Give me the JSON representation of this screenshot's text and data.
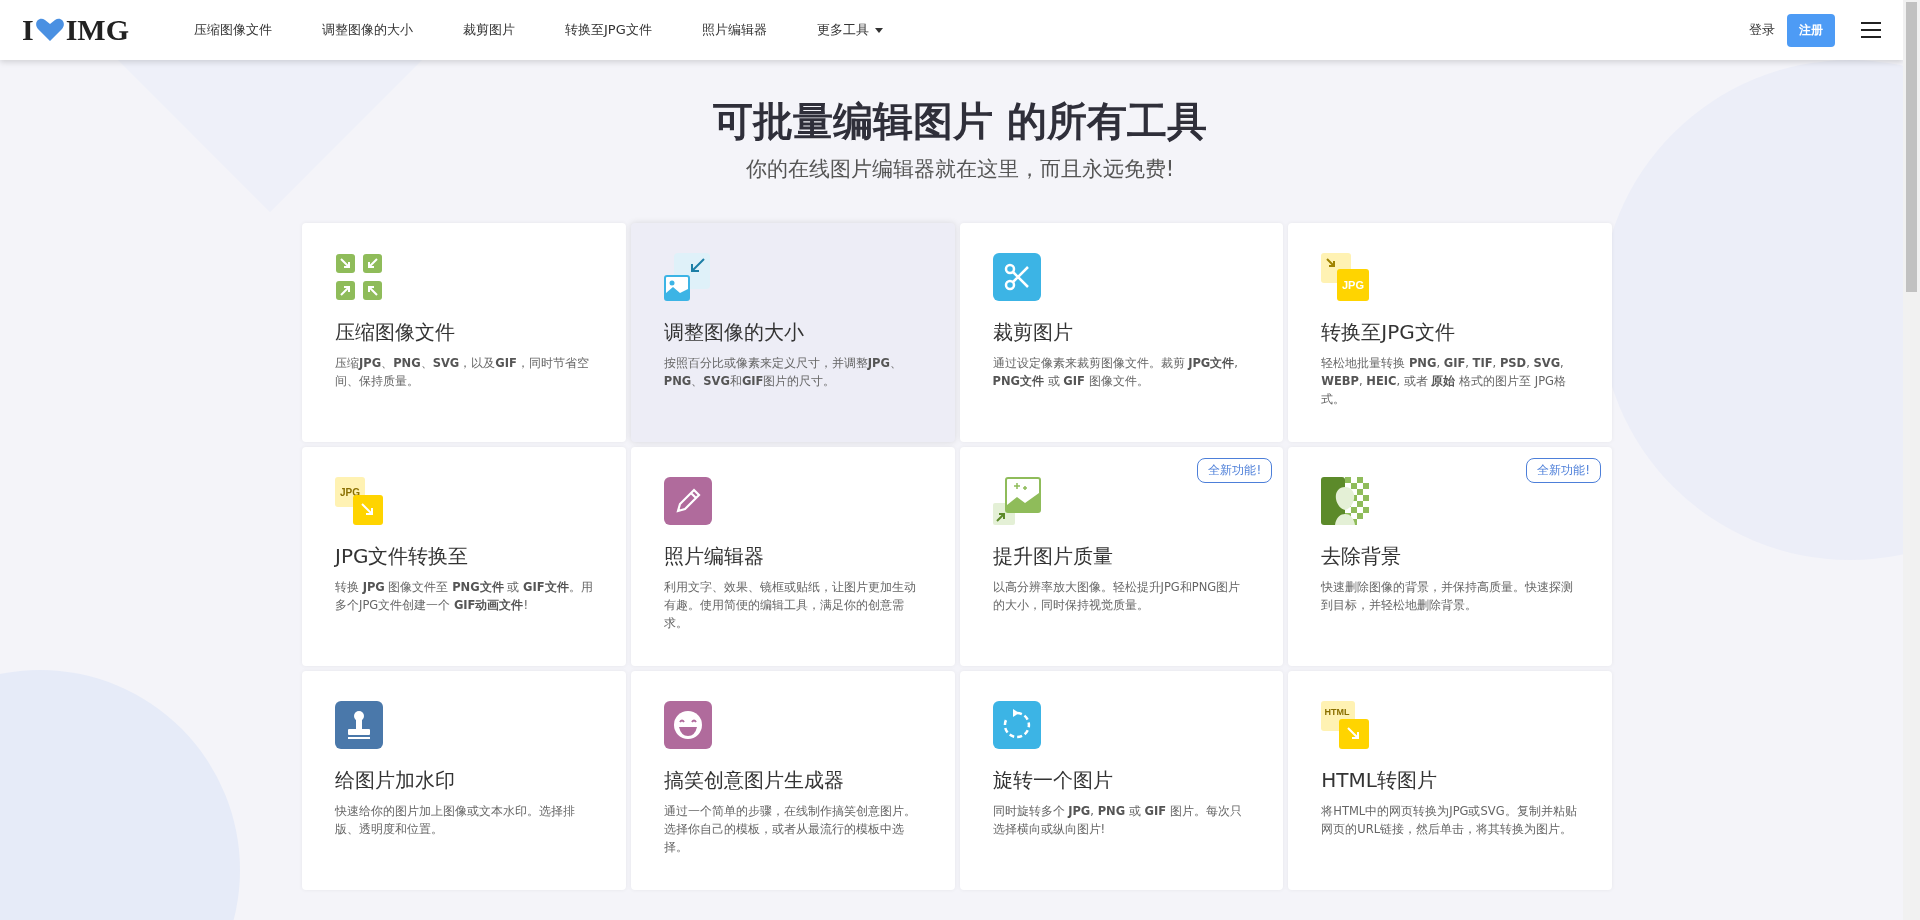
{
  "header": {
    "logo_left": "I",
    "logo_right": "IMG",
    "nav": [
      {
        "label": "压缩图像文件",
        "dropdown": false
      },
      {
        "label": "调整图像的大小",
        "dropdown": false
      },
      {
        "label": "裁剪图片",
        "dropdown": false
      },
      {
        "label": "转换至JPG文件",
        "dropdown": false
      },
      {
        "label": "照片编辑器",
        "dropdown": false
      },
      {
        "label": "更多工具",
        "dropdown": true
      }
    ],
    "login": "登录",
    "signup": "注册"
  },
  "hero": {
    "title": "可批量编辑图片 的所有工具",
    "subtitle": "你的在线图片编辑器就在这里，而且永远免费!"
  },
  "tools": [
    {
      "title": "压缩图像文件",
      "description": "压缩**JPG**、**PNG**、**SVG**，以及**GIF**，同时节省空间、保持质量。",
      "highlighted": false
    },
    {
      "title": "调整图像的大小",
      "description": "按照百分比或像素来定义尺寸，并调整**JPG**、**PNG**、**SVG**和**GIF**图片的尺寸。",
      "highlighted": true
    },
    {
      "title": "裁剪图片",
      "description": "通过设定像素来裁剪图像文件。裁剪 **JPG文件**, **PNG文件** 或 **GIF** 图像文件。",
      "highlighted": false
    },
    {
      "title": "转换至JPG文件",
      "description": "轻松地批量转换 **PNG**, **GIF**, **TIF**, **PSD**, **SVG**, **WEBP**, **HEIC**, 或者 **原始** 格式的图片至 JPG格式。",
      "highlighted": false,
      "icon_text": "JPG"
    },
    {
      "title": "JPG文件转换至",
      "description": "转换 **JPG** 图像文件至 **PNG文件** 或 **GIF文件**。用多个JPG文件创建一个 **GIF动画文件**!",
      "highlighted": false,
      "icon_text": "JPG"
    },
    {
      "title": "照片编辑器",
      "description": "利用文字、效果、镜框或贴纸，让图片更加生动有趣。使用简便的编辑工具，满足你的创意需求。",
      "highlighted": false
    },
    {
      "title": "提升图片质量",
      "description": "以高分辨率放大图像。轻松提升JPG和PNG图片的大小，同时保持视觉质量。",
      "highlighted": false,
      "badge": "全新功能!"
    },
    {
      "title": "去除背景",
      "description": "快速删除图像的背景，并保持高质量。快速探测到目标，并轻松地删除背景。",
      "highlighted": false,
      "badge": "全新功能!"
    },
    {
      "title": "给图片加水印",
      "description": "快速给你的图片加上图像或文本水印。选择排版、透明度和位置。",
      "highlighted": false
    },
    {
      "title": "搞笑创意图片生成器",
      "description": "通过一个简单的步骤，在线制作搞笑创意图片。选择你自己的模板，或者从最流行的模板中选择。",
      "highlighted": false
    },
    {
      "title": "旋转一个图片",
      "description": "同时旋转多个 **JPG**, **PNG** 或 **GIF** 图片。每次只选择横向或纵向图片!",
      "highlighted": false
    },
    {
      "title": "HTML转图片",
      "description": "将HTML中的网页转换为JPG或SVG。复制并粘贴网页的URL链接，然后单击，将其转换为图片。",
      "highlighted": false,
      "icon_text": "HTML"
    }
  ]
}
